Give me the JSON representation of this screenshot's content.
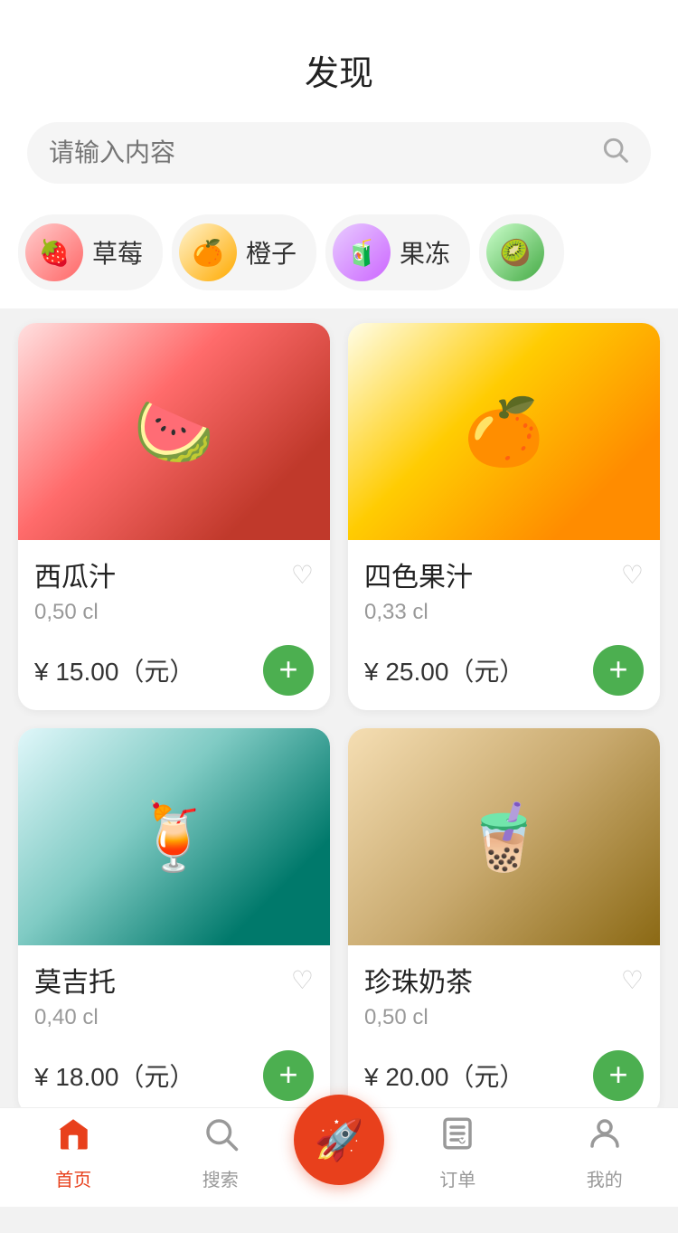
{
  "header": {
    "title": "发现"
  },
  "search": {
    "placeholder": "请输入内容"
  },
  "categories": [
    {
      "id": "strawberry",
      "label": "草莓",
      "emoji": "🍓",
      "colorClass": "cat-strawberry"
    },
    {
      "id": "orange",
      "label": "橙子",
      "emoji": "🍊",
      "colorClass": "cat-orange"
    },
    {
      "id": "jelly",
      "label": "果冻",
      "emoji": "🧃",
      "colorClass": "cat-jelly"
    },
    {
      "id": "extra",
      "label": "",
      "emoji": "🥝",
      "colorClass": "cat-extra"
    }
  ],
  "products": [
    {
      "id": "watermelon-juice",
      "name": "西瓜汁",
      "volume": "0,50 cl",
      "price": "¥ 15.00（元）",
      "imgClass": "img-watermelon",
      "emoji": "🍉"
    },
    {
      "id": "four-color-juice",
      "name": "四色果汁",
      "volume": "0,33 cl",
      "price": "¥ 25.00（元）",
      "imgClass": "img-citrus",
      "emoji": "🍊"
    },
    {
      "id": "mojito",
      "name": "莫吉托",
      "volume": "0,40 cl",
      "price": "¥ 18.00（元）",
      "imgClass": "img-mojito",
      "emoji": "🍹"
    },
    {
      "id": "bubble-tea",
      "name": "珍珠奶茶",
      "volume": "0,50 cl",
      "price": "¥ 20.00（元）",
      "imgClass": "img-bubbletea",
      "emoji": "🧋"
    }
  ],
  "nav": {
    "items": [
      {
        "id": "home",
        "label": "首页",
        "emoji": "🏠",
        "active": true
      },
      {
        "id": "search",
        "label": "搜索",
        "emoji": "🔍",
        "active": false
      },
      {
        "id": "order",
        "label": "订单",
        "emoji": "📋",
        "active": false
      },
      {
        "id": "mine",
        "label": "我的",
        "emoji": "👤",
        "active": false
      }
    ],
    "center_icon": "🚀"
  }
}
